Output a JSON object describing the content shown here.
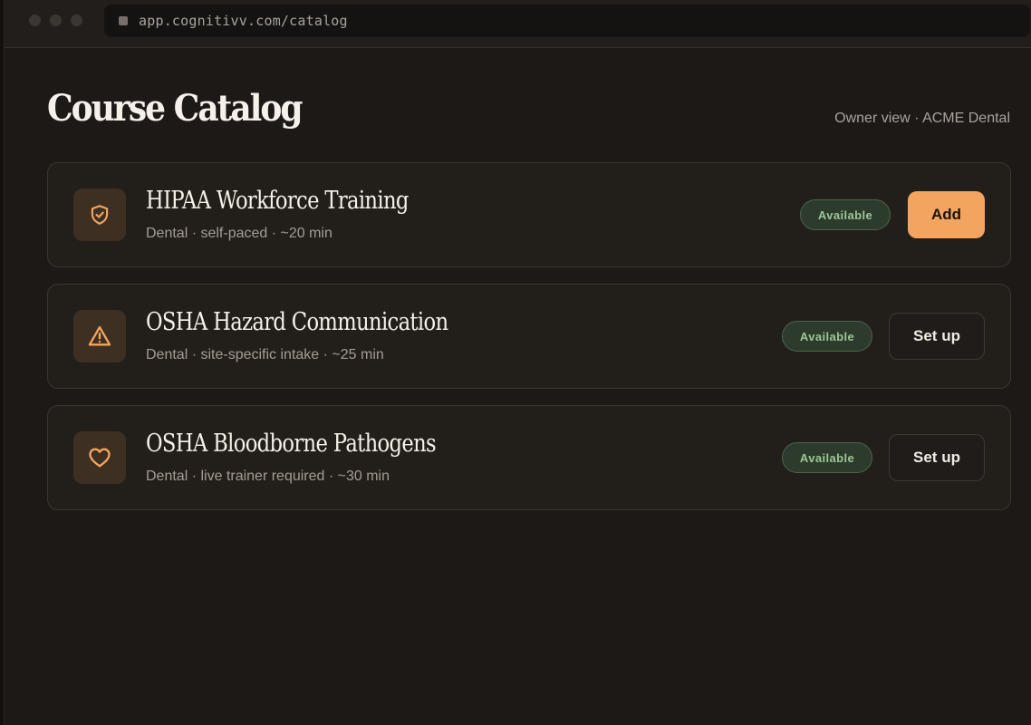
{
  "browser": {
    "url": "app.cognitivv.com/catalog"
  },
  "header": {
    "title": "Course Catalog",
    "context": "Owner view · ACME Dental"
  },
  "courses": [
    {
      "title": "HIPAA Workforce Training",
      "meta": "Dental · self-paced · ~20 min",
      "icon": "shield-check-icon",
      "status": "Available",
      "action": "Add",
      "action_style": "primary"
    },
    {
      "title": "OSHA Hazard Communication",
      "meta": "Dental · site-specific intake · ~25 min",
      "icon": "warning-triangle-icon",
      "status": "Available",
      "action": "Set up",
      "action_style": "secondary"
    },
    {
      "title": "OSHA Bloodborne Pathogens",
      "meta": "Dental · live trainer required · ~30 min",
      "icon": "heart-icon",
      "status": "Available",
      "action": "Set up",
      "action_style": "secondary"
    }
  ],
  "colors": {
    "background": "#1c1917",
    "accent": "#f3a55f",
    "status_green": "#9cc595"
  }
}
